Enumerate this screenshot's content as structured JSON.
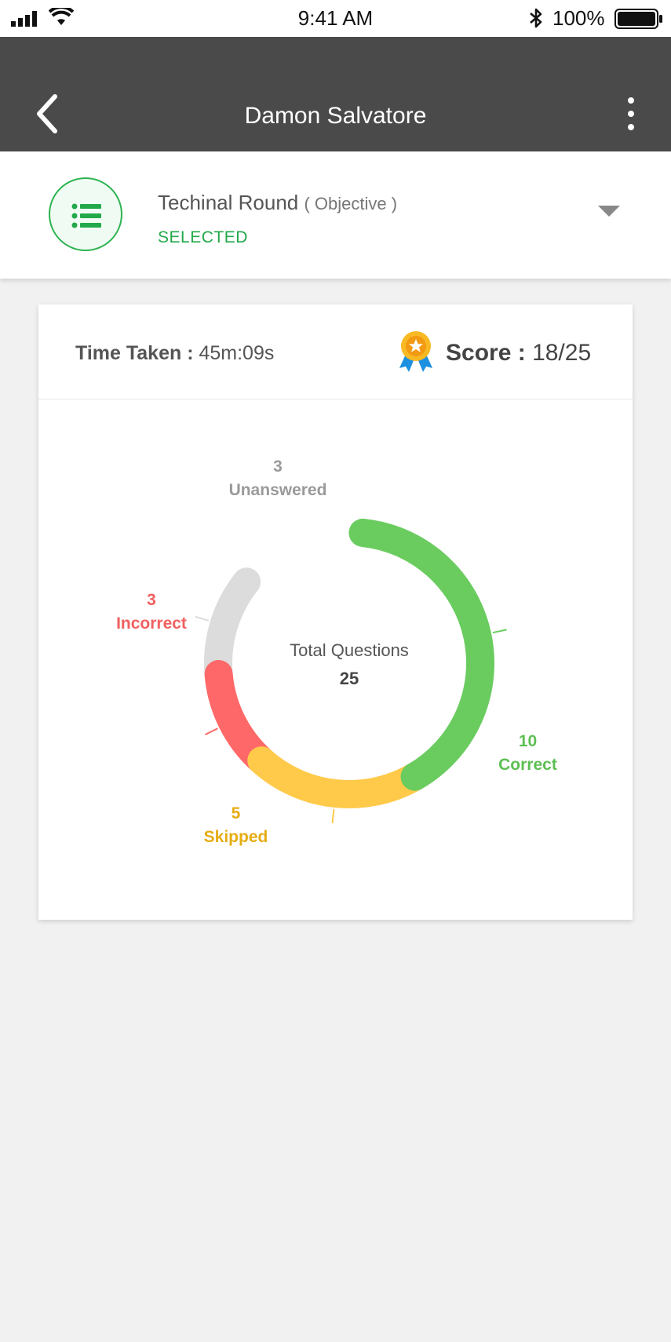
{
  "status_bar": {
    "time": "9:41 AM",
    "battery": "100%"
  },
  "app_bar": {
    "title": "Damon Salvatore"
  },
  "round": {
    "name": "Techinal Round",
    "type": "( Objective )",
    "status": "SELECTED"
  },
  "card": {
    "time_label": "Time Taken :",
    "time_value": "45m:09s",
    "score_label": "Score :",
    "score_value": "18/25"
  },
  "chart_data": {
    "type": "pie",
    "donut": true,
    "center_label": "Total Questions",
    "center_value": "25",
    "total": 25,
    "segments": [
      {
        "name": "Correct",
        "value": 10,
        "color": "#6acc5f"
      },
      {
        "name": "Skipped",
        "value": 5,
        "color": "#ffca4a"
      },
      {
        "name": "Incorrect",
        "value": 3,
        "color": "#ff6868"
      },
      {
        "name": "Unanswered",
        "value": 3,
        "color": "#dcdcdc"
      }
    ]
  },
  "colors": {
    "app_bar": "#4a4a4a",
    "accent_green": "#22a94a",
    "correct": "#5dbf52",
    "skipped": "#e6ac12",
    "incorrect": "#f06060",
    "unanswered": "#9a9a9a"
  },
  "icons": [
    "signal-icon",
    "wifi-icon",
    "bluetooth-icon",
    "battery-icon",
    "back-arrow-icon",
    "more-vertical-icon",
    "list-icon",
    "caret-down-icon",
    "medal-icon"
  ]
}
